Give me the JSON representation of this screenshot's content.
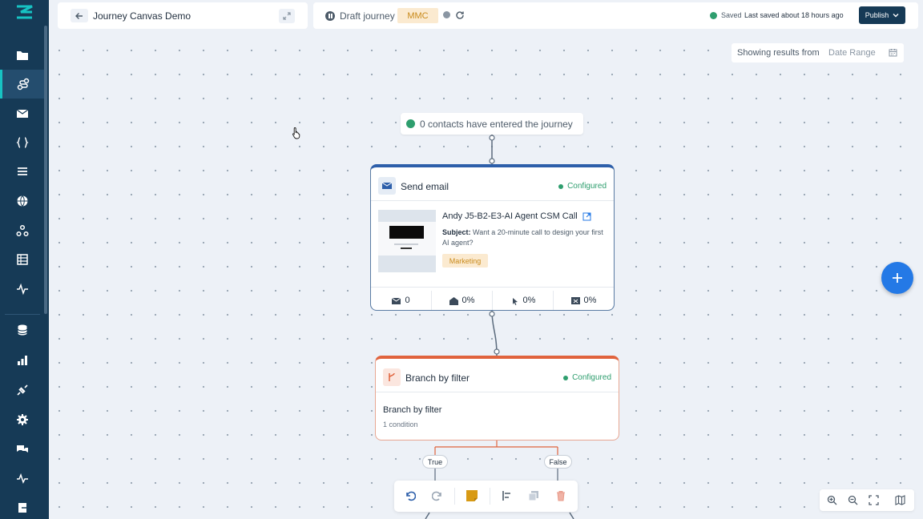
{
  "colors": {
    "sidebar": "#163a56",
    "accent": "#17c3c3",
    "email_border": "#2d5faa",
    "branch_border": "#e0633d",
    "configured": "#2e9e6e",
    "fab": "#2479e6"
  },
  "sidebar": {
    "items": [
      {
        "icon": "folder-icon"
      },
      {
        "icon": "journey-icon",
        "active": true
      },
      {
        "icon": "mail-icon"
      },
      {
        "icon": "code-braces-icon"
      },
      {
        "icon": "list-icon"
      },
      {
        "icon": "globe-icon"
      },
      {
        "icon": "webhook-icon"
      },
      {
        "icon": "table-icon"
      },
      {
        "icon": "activity-icon"
      },
      {
        "icon": "database-icon"
      },
      {
        "icon": "bar-chart-icon"
      },
      {
        "icon": "plug-icon"
      },
      {
        "icon": "settings-icon"
      },
      {
        "icon": "chat-icon"
      },
      {
        "icon": "pulse-icon"
      },
      {
        "icon": "exit-icon"
      }
    ]
  },
  "header": {
    "title": "Journey Canvas Demo",
    "draft_label": "Draft journey",
    "badge": "MMC",
    "saved_label": "Saved",
    "saved_time": "Last saved about 18 hours ago",
    "publish_label": "Publish"
  },
  "date_range": {
    "label": "Showing results from",
    "placeholder": "Date Range"
  },
  "entry": {
    "text": "0 contacts have entered the journey"
  },
  "email_node": {
    "title": "Send email",
    "status": "Configured",
    "email_name": "Andy J5-B2-E3-AI Agent CSM Call",
    "subject_label": "Subject:",
    "subject": "Want a 20-minute call to design your first AI agent?",
    "tag": "Marketing",
    "stats": [
      {
        "icon": "sent-icon",
        "value": "0"
      },
      {
        "icon": "open-icon",
        "value": "0%"
      },
      {
        "icon": "click-icon",
        "value": "0%"
      },
      {
        "icon": "bounce-icon",
        "value": "0%"
      }
    ]
  },
  "branch_node": {
    "title": "Branch by filter",
    "status": "Configured",
    "name": "Branch by filter",
    "condition": "1 condition",
    "true_label": "True",
    "false_label": "False"
  }
}
